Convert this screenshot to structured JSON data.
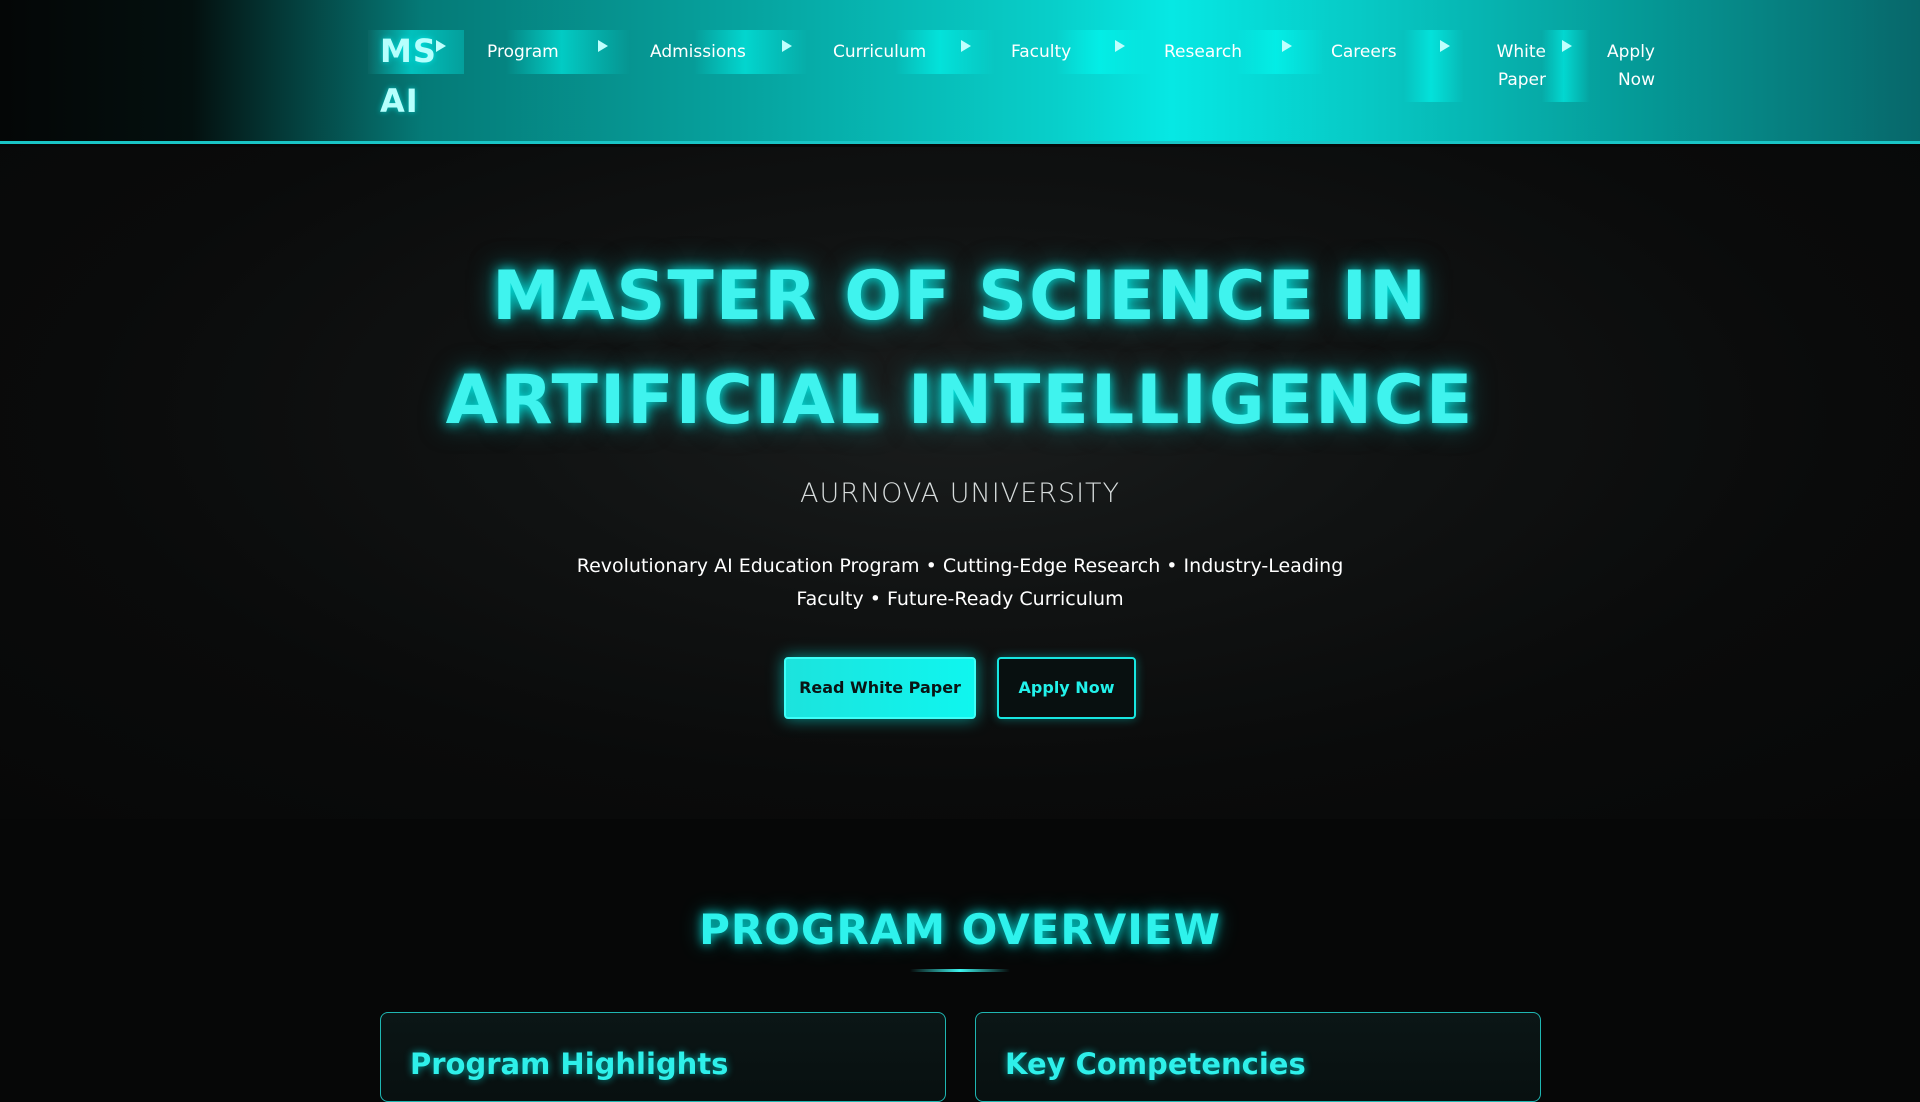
{
  "nav": {
    "logo": "MS AI",
    "links": [
      {
        "label": "Program"
      },
      {
        "label": "Admissions"
      },
      {
        "label": "Curriculum"
      },
      {
        "label": "Faculty"
      },
      {
        "label": "Research"
      },
      {
        "label": "Careers"
      },
      {
        "label": "White Paper"
      },
      {
        "label": "Apply Now"
      }
    ]
  },
  "hero": {
    "title": "MASTER OF SCIENCE IN ARTIFICIAL INTELLIGENCE",
    "subtitle": "AURNOVA UNIVERSITY",
    "tagline": "Revolutionary AI Education Program • Cutting-Edge Research • Industry-Leading Faculty • Future-Ready Curriculum",
    "primary_button": "Read White Paper",
    "secondary_button": "Apply Now"
  },
  "overview": {
    "title": "PROGRAM OVERVIEW",
    "cards": [
      {
        "title": "Program Highlights"
      },
      {
        "title": "Key Competencies"
      }
    ]
  },
  "colors": {
    "accent": "#2ef2ec",
    "background": "#060707",
    "nav_border": "#19c5c6"
  }
}
